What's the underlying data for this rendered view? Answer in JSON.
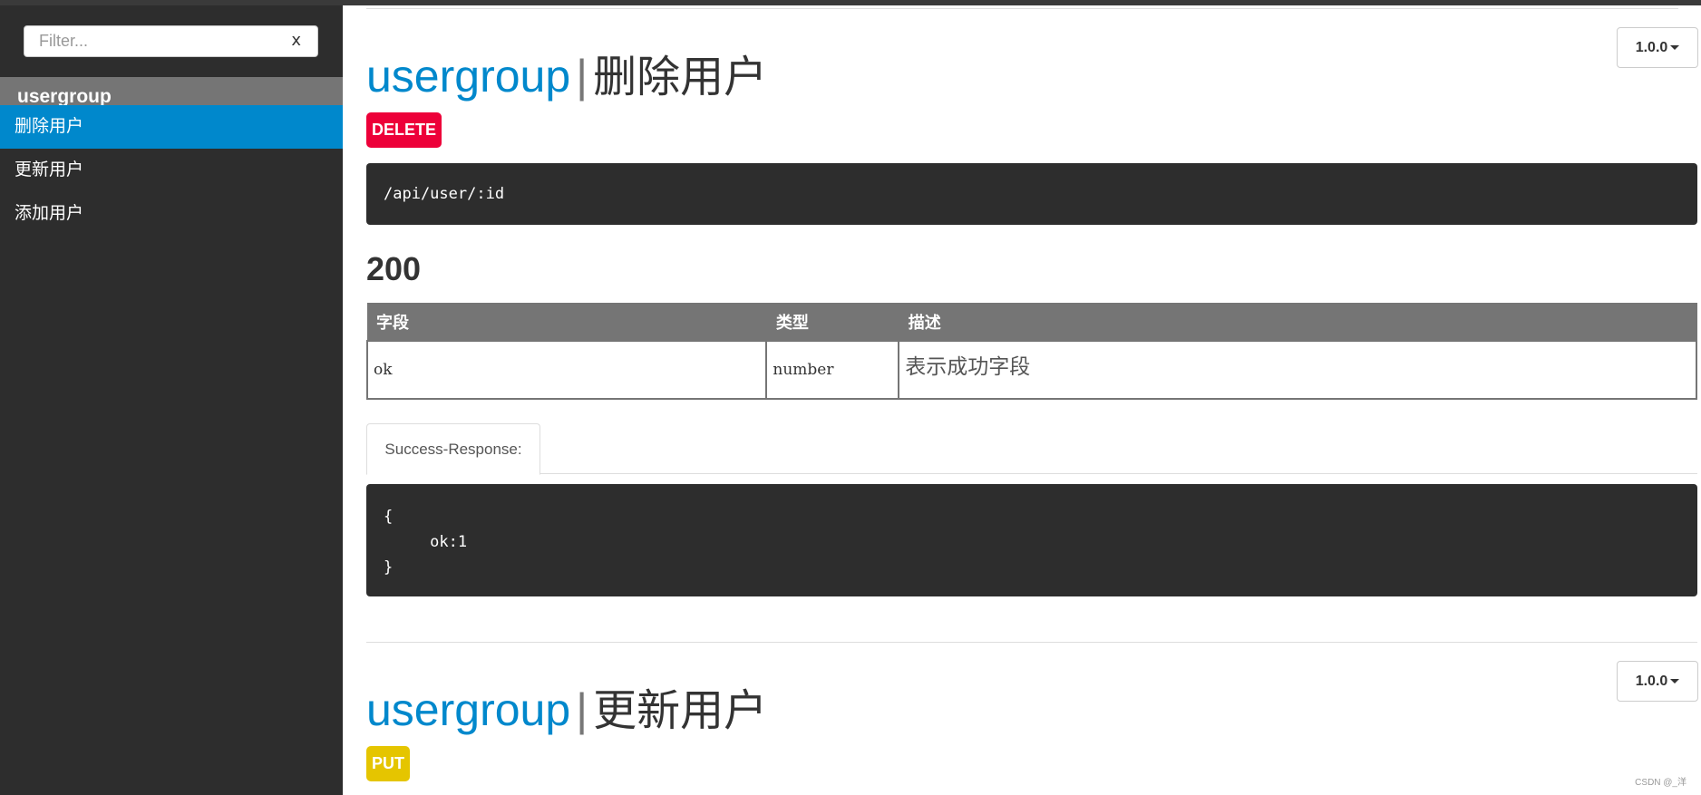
{
  "sidebar": {
    "filter_placeholder": "Filter...",
    "filter_clear": "x",
    "group_header": "usergroup",
    "items": [
      {
        "label": "删除用户",
        "active": true
      },
      {
        "label": "更新用户",
        "active": false
      },
      {
        "label": "添加用户",
        "active": false
      }
    ]
  },
  "sections": [
    {
      "group": "usergroup",
      "separator": "|",
      "name": "删除用户",
      "method": "DELETE",
      "version": "1.0.0",
      "url": "/api/user/:id",
      "status_code": "200",
      "table": {
        "headers": [
          "字段",
          "类型",
          "描述"
        ],
        "rows": [
          {
            "field": "ok",
            "type": "number",
            "desc": "表示成功字段"
          }
        ]
      },
      "tab_label": "Success-Response:",
      "response_lines": [
        "{",
        "     ok:1",
        "}"
      ]
    },
    {
      "group": "usergroup",
      "separator": "|",
      "name": "更新用户",
      "method": "PUT",
      "version": "1.0.0"
    }
  ],
  "colors": {
    "accent": "#0088cc",
    "delete": "#ed0039",
    "put": "#e5c500",
    "sidebar_bg": "#2d2d2d",
    "code_bg": "#2d2d2d"
  },
  "watermark": "CSDN @_洋"
}
